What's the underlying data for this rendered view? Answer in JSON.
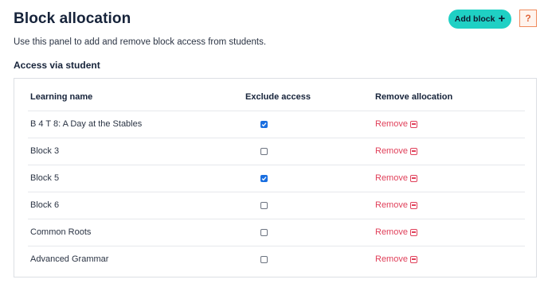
{
  "header": {
    "title": "Block allocation",
    "description": "Use this panel to add and remove block access from students.",
    "add_block_label": "Add block",
    "help_label": "?"
  },
  "section": {
    "title": "Access via student"
  },
  "table": {
    "columns": [
      "Learning name",
      "Exclude access",
      "Remove allocation"
    ],
    "rows": [
      {
        "name": "B 4 T 8: A Day at the Stables",
        "excluded": true,
        "action": "Remove"
      },
      {
        "name": "Block 3",
        "excluded": false,
        "action": "Remove"
      },
      {
        "name": "Block 5",
        "excluded": true,
        "action": "Remove"
      },
      {
        "name": "Block 6",
        "excluded": false,
        "action": "Remove"
      },
      {
        "name": "Common Roots",
        "excluded": false,
        "action": "Remove"
      },
      {
        "name": "Advanced Grammar",
        "excluded": false,
        "action": "Remove"
      }
    ]
  },
  "colors": {
    "accent": "#1fd0c4",
    "danger": "#e0405a",
    "help": "#f08a5c",
    "checkbox": "#1a6fe0"
  },
  "icons": {
    "add": "plus-icon",
    "remove": "minus-square-icon",
    "help": "question-icon"
  }
}
